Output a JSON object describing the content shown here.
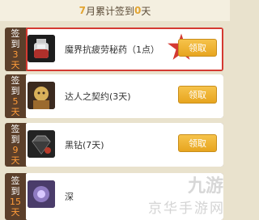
{
  "header": {
    "month": "7",
    "mid": "月累计签到",
    "count": "0",
    "unit": "天"
  },
  "rows": [
    {
      "side_top": "签",
      "side_mid": "到",
      "day": "3",
      "unit": "天",
      "name": "魔界抗疲劳秘药（1点）",
      "button": "领取",
      "icon": "potion-icon"
    },
    {
      "side_top": "签",
      "side_mid": "到",
      "day": "5",
      "unit": "天",
      "name": "达人之契约(3天)",
      "button": "领取",
      "icon": "portrait-icon"
    },
    {
      "side_top": "签",
      "side_mid": "到",
      "day": "9",
      "unit": "天",
      "name": "黑钻(7天)",
      "button": "领取",
      "icon": "black-diamond-icon"
    },
    {
      "side_top": "签",
      "side_mid": "到",
      "day": "15",
      "unit": "天",
      "name": "深",
      "button": "",
      "icon": "item-icon"
    }
  ],
  "watermark": {
    "top": "九游",
    "bottom": "京华手游网"
  },
  "colors": {
    "accent": "#e2a431",
    "button": "#f0b43a",
    "highlight": "#d43a32"
  }
}
